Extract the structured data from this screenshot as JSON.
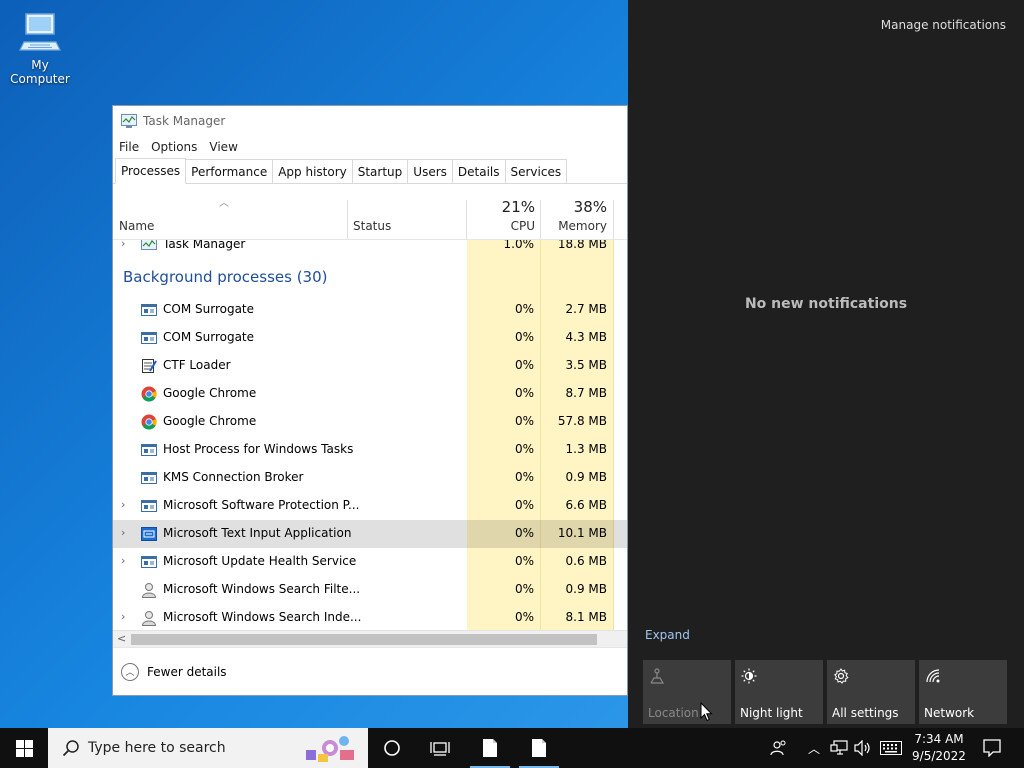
{
  "desktop": {
    "icons": [
      {
        "label": "My Computer",
        "icon": "computer-icon"
      }
    ]
  },
  "task_manager": {
    "title": "Task Manager",
    "menu": [
      "File",
      "Options",
      "View"
    ],
    "tabs": [
      "Processes",
      "Performance",
      "App history",
      "Startup",
      "Users",
      "Details",
      "Services"
    ],
    "active_tab": "Processes",
    "columns": {
      "name": "Name",
      "status": "Status",
      "cpu_label": "CPU",
      "cpu_percent": "21%",
      "memory_label": "Memory",
      "memory_percent": "38%"
    },
    "top_row": {
      "name": "Task Manager",
      "cpu": "1.0%",
      "mem": "18.8 MB"
    },
    "group_title": "Background processes (30)",
    "rows": [
      {
        "name": "COM Surrogate",
        "cpu": "0%",
        "mem": "2.7 MB",
        "icon": "window-icon",
        "expandable": false
      },
      {
        "name": "COM Surrogate",
        "cpu": "0%",
        "mem": "4.3 MB",
        "icon": "window-icon",
        "expandable": false
      },
      {
        "name": "CTF Loader",
        "cpu": "0%",
        "mem": "3.5 MB",
        "icon": "notepad-icon",
        "expandable": false
      },
      {
        "name": "Google Chrome",
        "cpu": "0%",
        "mem": "8.7 MB",
        "icon": "chrome-icon",
        "expandable": false
      },
      {
        "name": "Google Chrome",
        "cpu": "0%",
        "mem": "57.8 MB",
        "icon": "chrome-icon",
        "expandable": false
      },
      {
        "name": "Host Process for Windows Tasks",
        "cpu": "0%",
        "mem": "1.3 MB",
        "icon": "window-icon",
        "expandable": false
      },
      {
        "name": "KMS Connection Broker",
        "cpu": "0%",
        "mem": "0.9 MB",
        "icon": "window-icon",
        "expandable": false
      },
      {
        "name": "Microsoft Software Protection P...",
        "cpu": "0%",
        "mem": "6.6 MB",
        "icon": "window-icon",
        "expandable": true
      },
      {
        "name": "Microsoft Text Input Application",
        "cpu": "0%",
        "mem": "10.1 MB",
        "icon": "text-input-icon",
        "expandable": true,
        "selected": true
      },
      {
        "name": "Microsoft Update Health Service",
        "cpu": "0%",
        "mem": "0.6 MB",
        "icon": "window-icon",
        "expandable": true
      },
      {
        "name": "Microsoft Windows Search Filte...",
        "cpu": "0%",
        "mem": "0.9 MB",
        "icon": "search-user-icon",
        "expandable": false
      },
      {
        "name": "Microsoft Windows Search Inde...",
        "cpu": "0%",
        "mem": "8.1 MB",
        "icon": "search-user-icon",
        "expandable": true
      }
    ],
    "fewer_details": "Fewer details"
  },
  "action_center": {
    "manage_notifications": "Manage notifications",
    "no_notifications": "No new notifications",
    "expand": "Expand",
    "quick_actions": [
      {
        "label": "Location",
        "icon": "location-icon",
        "enabled": false
      },
      {
        "label": "Night light",
        "icon": "night-light-icon",
        "enabled": true
      },
      {
        "label": "All settings",
        "icon": "gear-icon",
        "enabled": true
      },
      {
        "label": "Network",
        "icon": "network-icon",
        "enabled": true
      }
    ]
  },
  "taskbar": {
    "search_placeholder": "Type here to search",
    "time": "7:34 AM",
    "date": "9/5/2022"
  }
}
